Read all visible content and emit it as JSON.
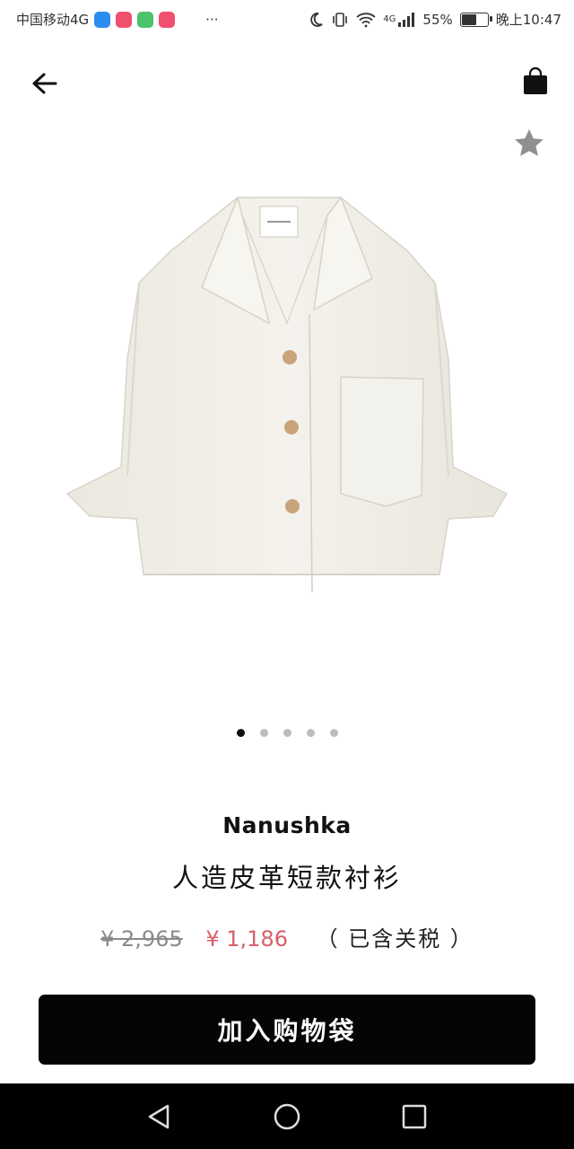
{
  "status_bar": {
    "carrier": "中国移动4G",
    "network": "4G",
    "battery": "55%",
    "battery_level": 0.55,
    "time": "晚上10:47",
    "more": "···"
  },
  "product": {
    "brand": "Nanushka",
    "title": "人造皮革短款衬衫",
    "original_price": "¥ 2,965",
    "sale_price": "¥ 1,186",
    "tax_note": "（ 已含关税 ）",
    "image_count": 5,
    "active_image": 1
  },
  "actions": {
    "add_to_bag": "加入购物袋"
  },
  "colors": {
    "sale_price": "#d86068",
    "button": "#050505",
    "shirt": "#f0eee7"
  }
}
